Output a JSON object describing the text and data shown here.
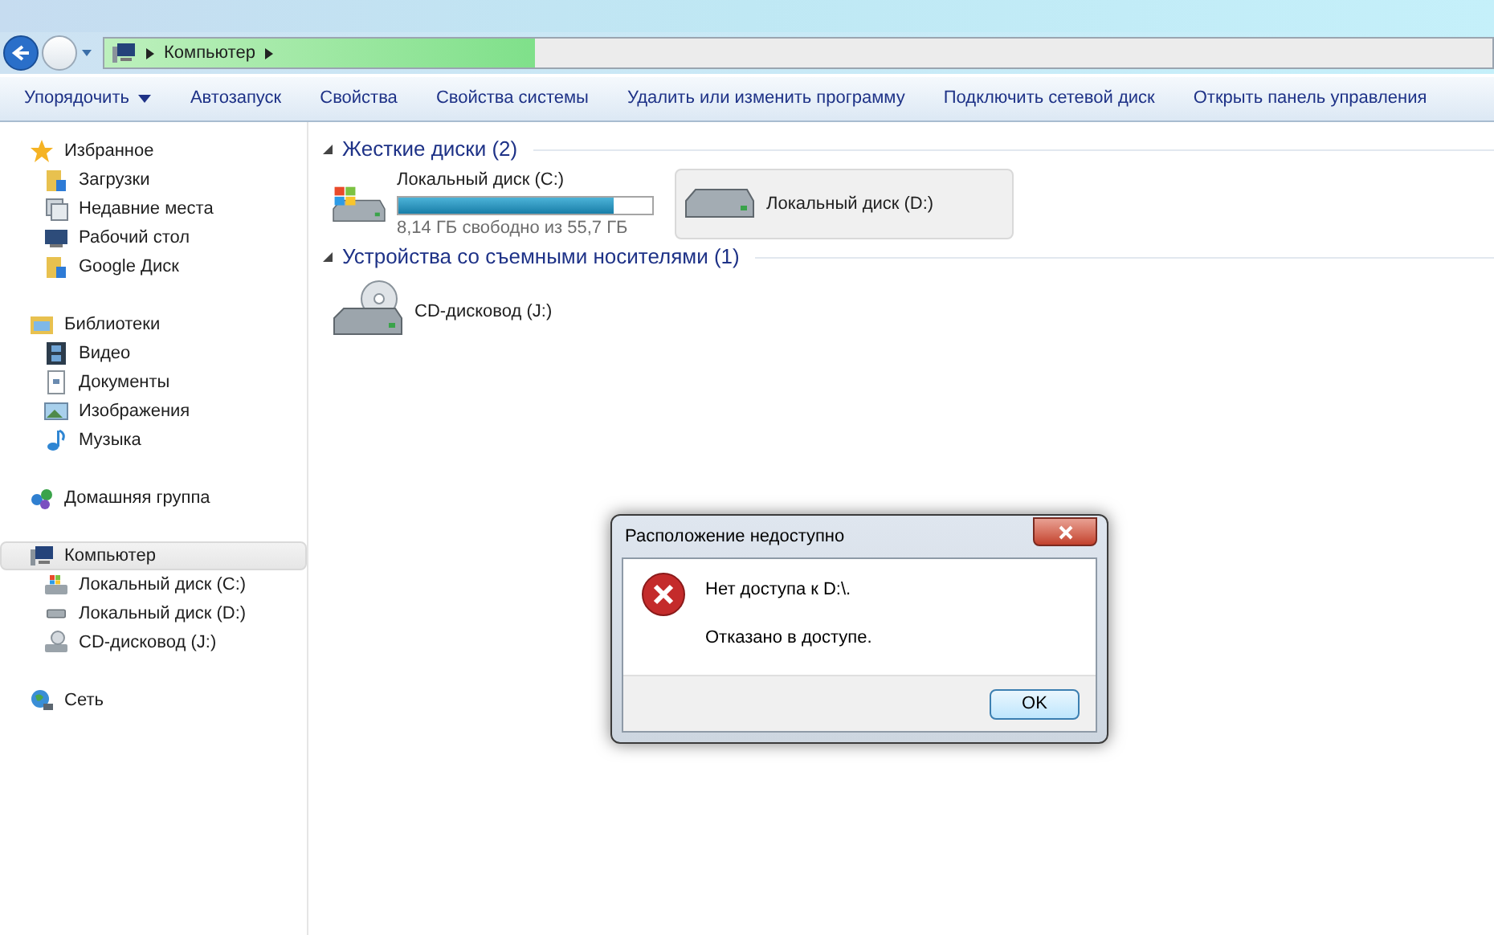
{
  "address_bar": {
    "crumbs": [
      "Компьютер"
    ],
    "level": 0.31
  },
  "toolbar": [
    {
      "label": "Упорядочить",
      "dropdown": true
    },
    {
      "label": "Автозапуск",
      "dropdown": false
    },
    {
      "label": "Свойства",
      "dropdown": false
    },
    {
      "label": "Свойства системы",
      "dropdown": false
    },
    {
      "label": "Удалить или изменить программу",
      "dropdown": false
    },
    {
      "label": "Подключить сетевой диск",
      "dropdown": false
    },
    {
      "label": "Открыть панель управления",
      "dropdown": false
    }
  ],
  "sidebar": [
    {
      "label": "Избранное",
      "kind": "star",
      "selected": false,
      "children": [
        {
          "label": "Загрузки",
          "kind": "folder",
          "selected": false
        },
        {
          "label": "Недавние места",
          "kind": "recent",
          "selected": false
        },
        {
          "label": "Рабочий стол",
          "kind": "desktop",
          "selected": false
        },
        {
          "label": "Google Диск",
          "kind": "folder",
          "selected": false
        }
      ]
    },
    {
      "label": "Библиотеки",
      "kind": "library",
      "selected": false,
      "children": [
        {
          "label": "Видео",
          "kind": "video",
          "selected": false
        },
        {
          "label": "Документы",
          "kind": "document",
          "selected": false
        },
        {
          "label": "Изображения",
          "kind": "image",
          "selected": false
        },
        {
          "label": "Музыка",
          "kind": "music",
          "selected": false
        }
      ]
    },
    {
      "label": "Домашняя группа",
      "kind": "homegroup",
      "selected": false
    },
    {
      "label": "Компьютер",
      "kind": "computer",
      "selected": true,
      "children": [
        {
          "label": "Локальный диск (C:)",
          "kind": "sysdrive",
          "selected": false
        },
        {
          "label": "Локальный диск (D:)",
          "kind": "drive",
          "selected": false
        },
        {
          "label": "CD-дисковод (J:)",
          "kind": "cd",
          "selected": false
        }
      ]
    },
    {
      "label": "Сеть",
      "kind": "network",
      "selected": false
    }
  ],
  "groups": [
    {
      "title": "Жесткие диски (2)",
      "items": [
        {
          "label": "Локальный диск (C:)",
          "kind": "sysdrive",
          "selected": false,
          "level": 0.85,
          "caption": "8,14 ГБ свободно из 55,7 ГБ"
        },
        {
          "label": "Локальный диск (D:)",
          "kind": "drive",
          "selected": true
        }
      ]
    },
    {
      "title": "Устройства со съемными носителями (1)",
      "items": [
        {
          "label": "CD-дисковод (J:)",
          "kind": "cd",
          "selected": false
        }
      ]
    }
  ],
  "dialog": {
    "title": "Расположение недоступно",
    "message": "Нет доступа к D:\\.",
    "detail": "Отказано в доступе.",
    "buttons": [
      "OK"
    ]
  }
}
